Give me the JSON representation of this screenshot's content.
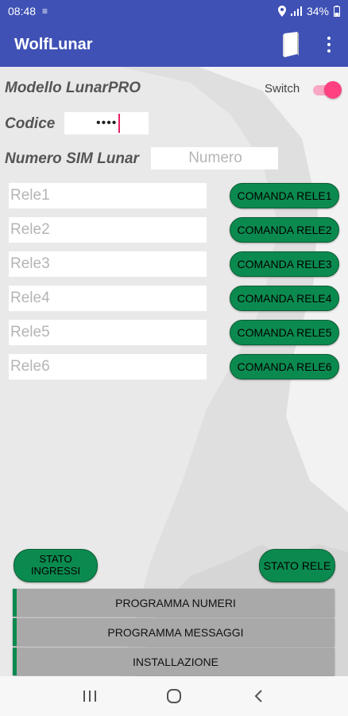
{
  "status": {
    "time": "08:48",
    "battery": "34%"
  },
  "app": {
    "title": "WolfLunar"
  },
  "form": {
    "model_label": "Modello LunarPRO",
    "switch_label": "Switch",
    "switch_on": true,
    "code_label": "Codice",
    "code_value": "••••",
    "sim_label": "Numero SIM Lunar",
    "sim_placeholder": "Numero"
  },
  "relays": [
    {
      "placeholder": "Rele1",
      "button": "COMANDA RELE1"
    },
    {
      "placeholder": "Rele2",
      "button": "COMANDA RELE2"
    },
    {
      "placeholder": "Rele3",
      "button": "COMANDA RELE3"
    },
    {
      "placeholder": "Rele4",
      "button": "COMANDA RELE4"
    },
    {
      "placeholder": "Rele5",
      "button": "COMANDA RELE5"
    },
    {
      "placeholder": "Rele6",
      "button": "COMANDA RELE6"
    }
  ],
  "actions": {
    "stato_ingressi_line1": "STATO",
    "stato_ingressi_line2": "INGRESSI",
    "stato_rele": "STATO RELE"
  },
  "menu": {
    "programma_numeri": "PROGRAMMA NUMERI",
    "programma_messaggi": "PROGRAMMA MESSAGGI",
    "installazione": "INSTALLAZIONE"
  },
  "colors": {
    "primary": "#3f51b5",
    "button_green": "#0b8a4f",
    "accent": "#ff4081"
  }
}
